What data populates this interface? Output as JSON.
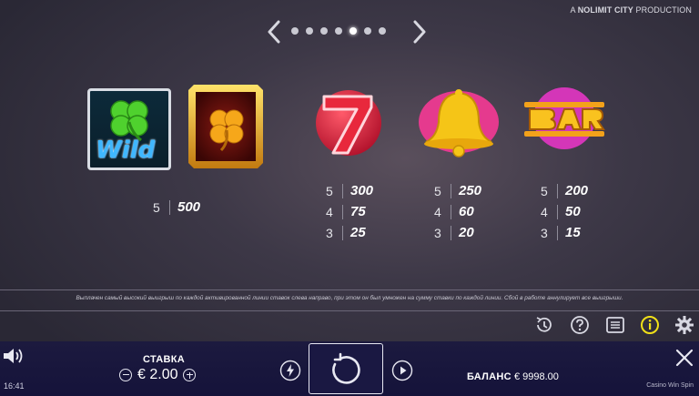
{
  "credit": {
    "prefix": "A",
    "brand": "NOLIMIT CITY",
    "suffix": "PRODUCTION"
  },
  "pager": {
    "pages": 7,
    "active_index": 4
  },
  "symbols": {
    "wild_label": "Wild"
  },
  "paytables": {
    "clover": [
      {
        "count": "5",
        "value": "500"
      }
    ],
    "seven": [
      {
        "count": "5",
        "value": "300"
      },
      {
        "count": "4",
        "value": "75"
      },
      {
        "count": "3",
        "value": "25"
      }
    ],
    "bell": [
      {
        "count": "5",
        "value": "250"
      },
      {
        "count": "4",
        "value": "60"
      },
      {
        "count": "3",
        "value": "20"
      }
    ],
    "bar": [
      {
        "count": "5",
        "value": "200"
      },
      {
        "count": "4",
        "value": "50"
      },
      {
        "count": "3",
        "value": "15"
      }
    ]
  },
  "rules_text": "Выплачен самый высокий выигрыш по каждой активированной линии ставок слева направо, при этом он был умножен на сумму ставки по каждой линии. Сбой в работе аннулирует все выигрыши.",
  "bottom": {
    "stake_label": "СТАВКА",
    "stake_value": "€ 2.00",
    "balance_label": "БАЛАНС",
    "balance_value": "€ 9998.00",
    "time": "16:41",
    "brand": "Casino Win Spin"
  },
  "icons": [
    "arrow-left-icon",
    "arrow-right-icon",
    "history-icon",
    "help-icon",
    "paytable-icon",
    "info-icon",
    "gear-icon",
    "speaker-icon",
    "bolt-icon",
    "spin-icon",
    "autoplay-icon",
    "close-icon"
  ],
  "colors": {
    "info_active": "#f0e018",
    "background": "#3d3847",
    "bottom_bar": "#1c1a3f"
  }
}
